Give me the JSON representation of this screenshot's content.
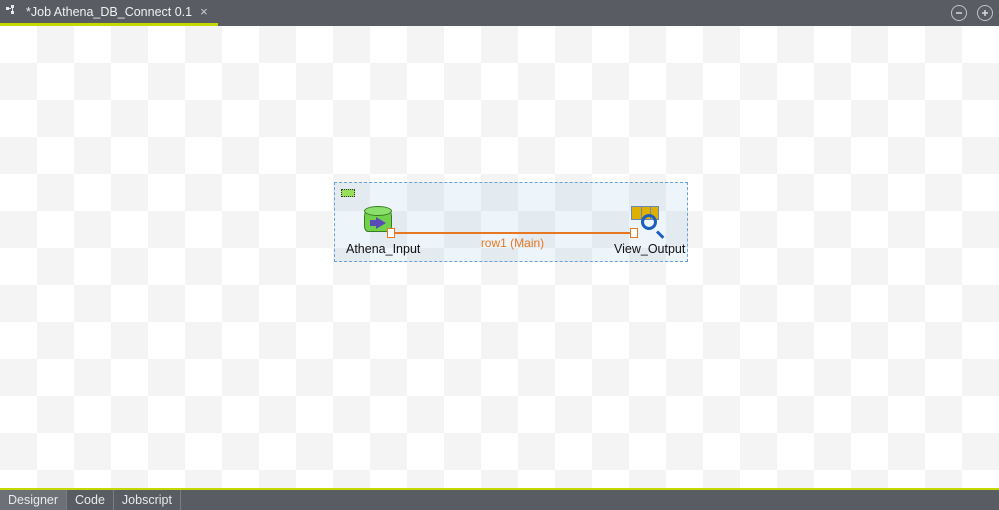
{
  "tab": {
    "title": "*Job Athena_DB_Connect 0.1",
    "icon": "job-icon",
    "close_glyph": "×"
  },
  "header_buttons": {
    "minimize_glyph": "⊖",
    "maximize_glyph": "⊕"
  },
  "canvas": {
    "nodes": [
      {
        "id": "athena_input",
        "label": "Athena_Input",
        "icon": "db-input-icon"
      },
      {
        "id": "view_output",
        "label": "View_Output",
        "icon": "table-view-icon"
      }
    ],
    "connections": [
      {
        "from": "athena_input",
        "to": "view_output",
        "label": "row1 (Main)"
      }
    ],
    "colors": {
      "link": "#e87722",
      "selection": "#6aa0d8"
    }
  },
  "footer_tabs": [
    {
      "id": "designer",
      "label": "Designer",
      "active": true
    },
    {
      "id": "code",
      "label": "Code",
      "active": false
    },
    {
      "id": "jobscript",
      "label": "Jobscript",
      "active": false
    }
  ]
}
